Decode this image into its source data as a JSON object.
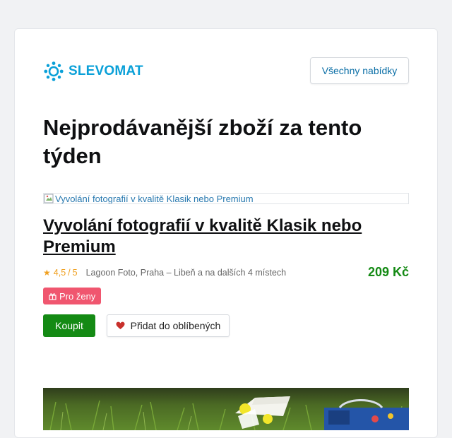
{
  "brand": {
    "logo_text": "SLEVOMAT",
    "logo_icon": "gear-icon",
    "color": "#0aa0d8"
  },
  "header": {
    "all_offers_label": "Všechny nabídky"
  },
  "page_title": "Nejprodávanější zboží za tento týden",
  "deal": {
    "image_alt": "Vyvolání fotografií v kvalitě Klasik nebo Premium",
    "title": "Vyvolání fotografií v kvalitě Klasik nebo Premium",
    "rating": "4,5",
    "rating_sep": "/",
    "rating_max": "5",
    "location": "Lagoon Foto, Praha – Libeň a na dalších 4 místech",
    "price": "209 Kč",
    "badge": "Pro ženy",
    "badge_icon": "gift-icon",
    "buy_label": "Koupit",
    "favorite_label": "Přidat do oblíbených",
    "favorite_icon": "heart-icon"
  },
  "colors": {
    "price": "#148a14",
    "buy_button": "#148a14",
    "badge": "#f0566f",
    "rating": "#f0a020",
    "link": "#0a6ea6"
  }
}
